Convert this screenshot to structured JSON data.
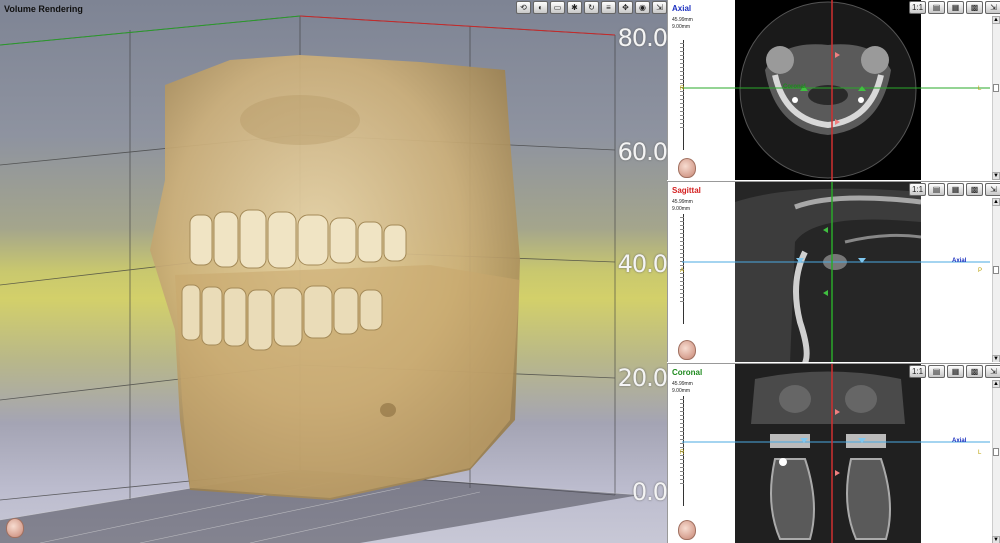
{
  "volume": {
    "title": "Volume Rendering",
    "scale_labels": [
      "80.0",
      "60.0",
      "40.0",
      "20.0",
      "0.0"
    ],
    "toolbar_icons": [
      "reset-view-icon",
      "render-mode-icon",
      "clip-icon",
      "light-icon",
      "rotate-icon",
      "layers-icon",
      "pan-icon",
      "snapshot-icon",
      "export-icon"
    ]
  },
  "views": [
    {
      "id": "axial",
      "title": "Axial",
      "title_color": "#1a2fbf",
      "info_lines": [
        "45.99mm",
        "9.00mm"
      ],
      "ref_label": "Coronal",
      "ref_color": "#1e8a1e",
      "left_side": "R",
      "right_side": "L"
    },
    {
      "id": "sagittal",
      "title": "Sagittal",
      "title_color": "#d42020",
      "info_lines": [
        "45.99mm",
        "9.00mm"
      ],
      "ref_label": "Axial",
      "ref_color": "#1a2fbf",
      "left_side": "A",
      "right_side": "P"
    },
    {
      "id": "coronal",
      "title": "Coronal",
      "title_color": "#1e8a1e",
      "info_lines": [
        "45.99mm",
        "9.00mm"
      ],
      "ref_label": "Axial",
      "ref_color": "#1a2fbf",
      "left_side": "R",
      "right_side": "L"
    }
  ],
  "view_tool_icons": [
    "layout-1x1-icon",
    "window-level-icon",
    "measure-icon",
    "screenshot-icon",
    "export-icon"
  ]
}
